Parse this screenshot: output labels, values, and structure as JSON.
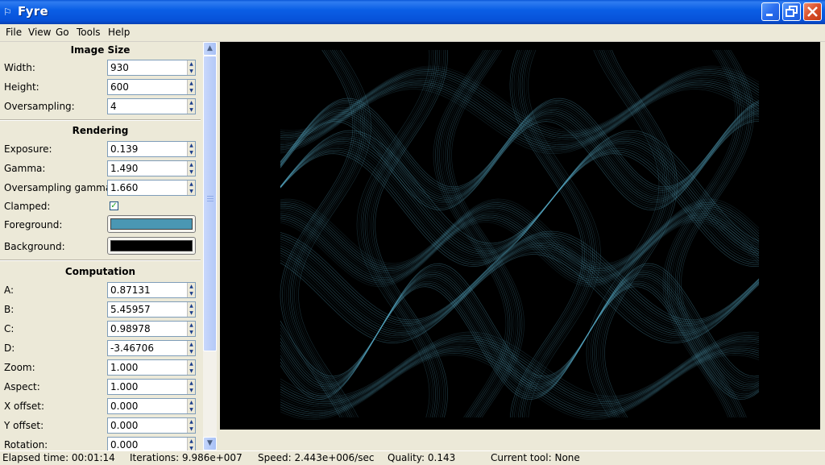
{
  "window": {
    "title": "Fyre"
  },
  "menu": [
    "File",
    "View",
    "Go",
    "Tools",
    "Help"
  ],
  "sections": {
    "image_size": "Image Size",
    "rendering": "Rendering",
    "computation": "Computation"
  },
  "fields": {
    "width": {
      "label": "Width:",
      "value": "930"
    },
    "height": {
      "label": "Height:",
      "value": "600"
    },
    "oversampling": {
      "label": "Oversampling:",
      "value": "4"
    },
    "exposure": {
      "label": "Exposure:",
      "value": "0.139"
    },
    "gamma": {
      "label": "Gamma:",
      "value": "1.490"
    },
    "oversampling_gamma": {
      "label": "Oversampling gamma:",
      "value": "1.660"
    },
    "clamped": {
      "label": "Clamped:",
      "checked": true
    },
    "foreground": {
      "label": "Foreground:",
      "color": "#4a97b3"
    },
    "background": {
      "label": "Background:",
      "color": "#000000"
    },
    "a": {
      "label": "A:",
      "value": "0.87131"
    },
    "b": {
      "label": "B:",
      "value": "5.45957"
    },
    "c": {
      "label": "C:",
      "value": "0.98978"
    },
    "d": {
      "label": "D:",
      "value": "-3.46706"
    },
    "zoom": {
      "label": "Zoom:",
      "value": "1.000"
    },
    "aspect": {
      "label": "Aspect:",
      "value": "1.000"
    },
    "x_offset": {
      "label": "X offset:",
      "value": "0.000"
    },
    "y_offset": {
      "label": "Y offset:",
      "value": "0.000"
    },
    "rotation": {
      "label": "Rotation:",
      "value": "0.000"
    }
  },
  "status": {
    "elapsed": "Elapsed time: 00:01:14",
    "iterations": "Iterations: 9.986e+007",
    "speed": "Speed: 2.443e+006/sec",
    "quality": "Quality: 0.143",
    "tool": "Current tool: None"
  },
  "colors": {
    "render_stroke": "#5fb6d4",
    "render_background": "#000000"
  }
}
